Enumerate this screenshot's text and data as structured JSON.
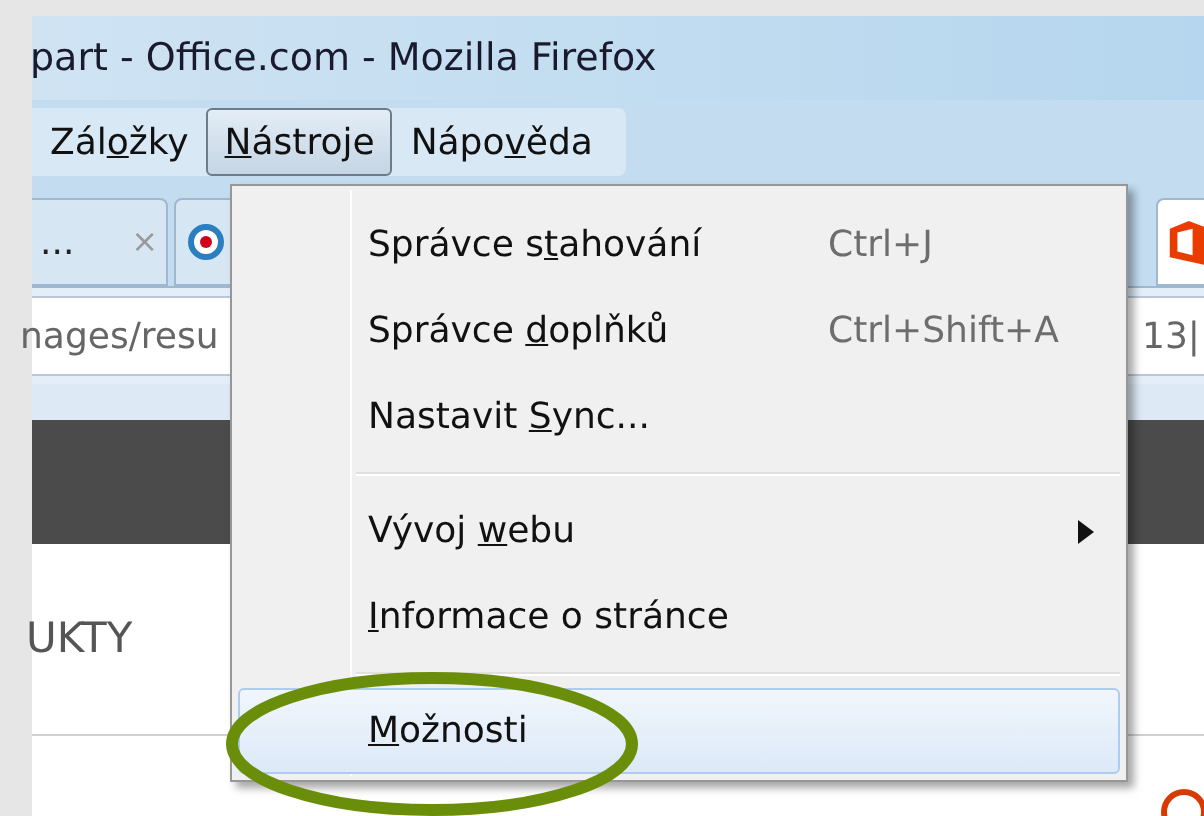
{
  "window": {
    "title": "part - Office.com - Mozilla Firefox"
  },
  "menubar": [
    {
      "before": "Zál",
      "key": "o",
      "after": "žky",
      "selected": false
    },
    {
      "key": "N",
      "after": "ástroje",
      "selected": true
    },
    {
      "before": "Nápo",
      "key": "v",
      "after": "ěda",
      "selected": false
    }
  ],
  "tabs": [
    {
      "kind": "text",
      "label": "...",
      "close": "×"
    },
    {
      "kind": "icon"
    }
  ],
  "address_bar": {
    "value": "nages/resu",
    "value_end": "13|"
  },
  "page": {
    "nav_item": "UKTY"
  },
  "menu": {
    "items": [
      {
        "kind": "item",
        "before": "Správce s",
        "key": "t",
        "after": "ahování",
        "shortcut": "Ctrl+J",
        "selected": false
      },
      {
        "kind": "item",
        "before": "Správce ",
        "key": "d",
        "after": "oplňků",
        "shortcut": "Ctrl+Shift+A",
        "selected": false
      },
      {
        "kind": "item",
        "before": "Nastavit ",
        "key": "S",
        "after": "ync...",
        "selected": false
      },
      {
        "kind": "separator"
      },
      {
        "kind": "submenu",
        "before": "Vývoj ",
        "key": "w",
        "after": "ebu",
        "selected": false
      },
      {
        "kind": "item",
        "key": "I",
        "after": "nformace o stránce",
        "selected": false
      },
      {
        "kind": "separator"
      },
      {
        "kind": "item",
        "key": "M",
        "after": "ožnosti",
        "selected": true
      }
    ]
  },
  "annotation": {
    "kind": "ellipse"
  }
}
